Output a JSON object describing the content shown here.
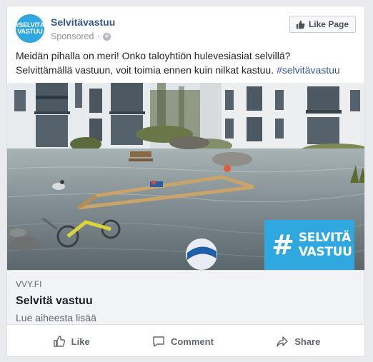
{
  "page": {
    "name": "Selvitävastuu",
    "sponsored": "Sponsored",
    "dot": "·",
    "avatar_text_1": "#SELVITÄ",
    "avatar_text_2": "VASTUU",
    "like_page": "Like Page"
  },
  "post": {
    "text_line1": "Meidän pihalla on meri! Onko taloyhtiön hulevesiasiat selvillä?",
    "text_line2": "Selvittämällä vastuun, voit toimia ennen kuin nilkat kastuu. ",
    "hashtag": "#selvitävastuu"
  },
  "image": {
    "logo_line1": "SELVITÄ",
    "logo_line2": "VASTUU",
    "logo_hash": "#",
    "logo_color": "#2fa8df"
  },
  "link": {
    "domain": "VVY.FI",
    "title": "Selvitä vastuu",
    "description": "Lue aiheesta lisää"
  },
  "actions": {
    "like": "Like",
    "comment": "Comment",
    "share": "Share"
  },
  "colors": {
    "link_blue": "#365899",
    "background": "#e9ebee"
  }
}
